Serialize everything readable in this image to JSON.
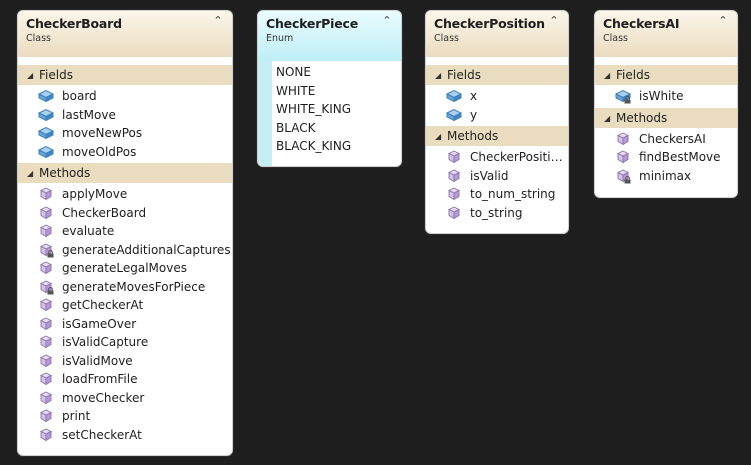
{
  "colors": {
    "background": "#1e1e1e",
    "class_header": "#ebdcc0",
    "enum_header": "#bdeff6",
    "section_header": "#e9dcbf",
    "field_icon": "#4a90c8",
    "method_icon": "#9b7fc0"
  },
  "classes": [
    {
      "title": "CheckerBoard",
      "stereotype": "Class",
      "fields_label": "Fields",
      "fields": [
        "board",
        "lastMove",
        "moveNewPos",
        "moveOldPos"
      ],
      "methods_label": "Methods",
      "methods": [
        {
          "name": "applyMove",
          "private": false
        },
        {
          "name": "CheckerBoard",
          "private": false
        },
        {
          "name": "evaluate",
          "private": false
        },
        {
          "name": "generateAdditionalCaptures",
          "private": true
        },
        {
          "name": "generateLegalMoves",
          "private": false
        },
        {
          "name": "generateMovesForPiece",
          "private": true
        },
        {
          "name": "getCheckerAt",
          "private": false
        },
        {
          "name": "isGameOver",
          "private": false
        },
        {
          "name": "isValidCapture",
          "private": false
        },
        {
          "name": "isValidMove",
          "private": false
        },
        {
          "name": "loadFromFile",
          "private": false
        },
        {
          "name": "moveChecker",
          "private": false
        },
        {
          "name": "print",
          "private": false
        },
        {
          "name": "setCheckerAt",
          "private": false
        }
      ]
    },
    {
      "title": "CheckerPosition",
      "stereotype": "Class",
      "fields_label": "Fields",
      "fields": [
        "x",
        "y"
      ],
      "methods_label": "Methods",
      "methods": [
        {
          "name": "CheckerPositio...",
          "private": false
        },
        {
          "name": "isValid",
          "private": false
        },
        {
          "name": "to_num_string",
          "private": false
        },
        {
          "name": "to_string",
          "private": false
        }
      ]
    },
    {
      "title": "CheckersAI",
      "stereotype": "Class",
      "fields_label": "Fields",
      "fields": [
        "isWhite"
      ],
      "fields_private": [
        true
      ],
      "methods_label": "Methods",
      "methods": [
        {
          "name": "CheckersAI",
          "private": false
        },
        {
          "name": "findBestMove",
          "private": false
        },
        {
          "name": "minimax",
          "private": true
        }
      ]
    }
  ],
  "enum": {
    "title": "CheckerPiece",
    "stereotype": "Enum",
    "values": [
      "NONE",
      "WHITE",
      "WHITE_KING",
      "BLACK",
      "BLACK_KING"
    ]
  },
  "icons": {
    "collapse": "double-chevron-up-icon",
    "field": "field-icon",
    "method": "method-icon",
    "lock": "lock-icon",
    "section_toggle": "triangle-down-icon"
  }
}
